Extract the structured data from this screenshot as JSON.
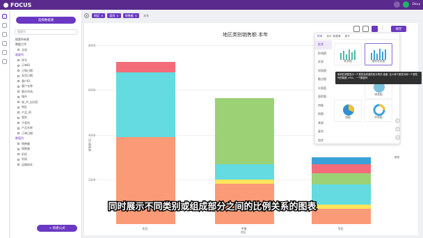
{
  "app": {
    "brand": "FOCUS",
    "user": "Davy"
  },
  "sidebar": {
    "new_dataset": "选择数据源",
    "search_placeholder": "搜索列",
    "items": [
      {
        "label": "搜索所有表",
        "type": "head"
      },
      {
        "label": "数据工作",
        "type": "head"
      },
      {
        "label": "全选",
        "type": "item"
      },
      {
        "label": "维度列",
        "type": "group"
      },
      {
        "label": "序号",
        "type": "item"
      },
      {
        "label": "订单ID",
        "type": "item"
      },
      {
        "label": "订购日期",
        "type": "item"
      },
      {
        "label": "发货日期",
        "type": "item"
      },
      {
        "label": "客户ID",
        "type": "item"
      },
      {
        "label": "客户名称",
        "type": "item"
      },
      {
        "label": "细分市场",
        "type": "item"
      },
      {
        "label": "城市",
        "type": "item"
      },
      {
        "label": "省_市_自治区",
        "type": "item"
      },
      {
        "label": "地区",
        "type": "item"
      },
      {
        "label": "产品_ID",
        "type": "item"
      },
      {
        "label": "类别",
        "type": "item"
      },
      {
        "label": "子类别",
        "type": "item"
      },
      {
        "label": "产品名称",
        "type": "item"
      },
      {
        "label": "订单日期",
        "type": "item"
      },
      {
        "label": "数值列",
        "type": "group"
      },
      {
        "label": "销售额",
        "type": "item"
      },
      {
        "label": "销售量",
        "type": "item"
      },
      {
        "label": "折扣",
        "type": "item"
      },
      {
        "label": "利润",
        "type": "item"
      },
      {
        "label": "运输成本",
        "type": "item"
      }
    ],
    "new_formula": "+ 新建公式"
  },
  "search": {
    "chips": [
      {
        "label": "地区",
        "close": "×"
      },
      {
        "label": "类别",
        "close": "×"
      },
      {
        "label": "销售额",
        "close": "×"
      }
    ],
    "plain": "本年",
    "clear": "×"
  },
  "toolbar": {
    "execute": "保存"
  },
  "chart_data": {
    "type": "bar",
    "title": "地区类别销售额 本年",
    "xlabel": "地区",
    "ylabel": "销售额(元)",
    "yticks": [
      "8000",
      "6000",
      "4000",
      "2000"
    ],
    "categories": [
      "东北",
      "中南",
      "华北"
    ],
    "ylim": [
      0,
      8000
    ],
    "series": [
      {
        "color": "#fa9a77",
        "values": [
          3900,
          1800,
          700
        ]
      },
      {
        "color": "#ffe45c",
        "values": [
          0,
          180,
          180
        ]
      },
      {
        "color": "#63dbe0",
        "values": [
          2900,
          700,
          900
        ]
      },
      {
        "color": "#9cd176",
        "values": [
          0,
          2950,
          500
        ]
      },
      {
        "color": "#f26c79",
        "values": [
          450,
          0,
          400
        ]
      },
      {
        "color": "#3aa0d8",
        "values": [
          0,
          0,
          300
        ]
      }
    ]
  },
  "panel": {
    "tabs": [
      "样例",
      "选中: 数据源",
      "调节"
    ],
    "categories": [
      "柱状",
      "折线图",
      "柱状",
      "饼状图",
      "散点图",
      "仪表盘",
      "面积图",
      "特殊",
      "地图",
      "其他",
      "复合",
      "组合"
    ],
    "thumbs": [
      {
        "label": "柱状图"
      },
      {
        "label": "堆积柱状图"
      },
      {
        "label": "比例图"
      },
      {
        "label": "饼状图"
      },
      {
        "label": "饼图"
      },
      {
        "label": "环状图"
      }
    ],
    "tooltip": "堆积柱状图显示一个属性及其值的统计情况 维度: 至少两个属性列和一个属性列的数据 <5%，一个数值列",
    "legend": "图例"
  },
  "caption": "同时展示不同类别或组成部分之间的比例关系的图表"
}
